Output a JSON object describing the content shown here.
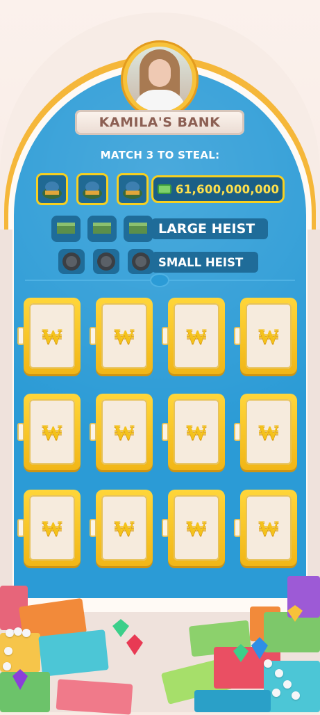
{
  "bank": {
    "owner_title": "KAMILA'S BANK"
  },
  "heist": {
    "instruction": "MATCH 3 TO STEAL:",
    "top_reward": {
      "amount": "61,600,000,000",
      "icon": "cash-stack-icon"
    },
    "tiers": [
      {
        "label": "LARGE HEIST",
        "icon": "cash-bundle-icon"
      },
      {
        "label": "SMALL HEIST",
        "icon": "coin-icon"
      }
    ]
  },
  "vault_doors": [
    {
      "logo": "₩"
    },
    {
      "logo": "₩"
    },
    {
      "logo": "₩"
    },
    {
      "logo": "₩"
    },
    {
      "logo": "₩"
    },
    {
      "logo": "₩"
    },
    {
      "logo": "₩"
    },
    {
      "logo": "₩"
    },
    {
      "logo": "₩"
    },
    {
      "logo": "₩"
    },
    {
      "logo": "₩"
    },
    {
      "logo": "₩"
    }
  ],
  "colors": {
    "panel": "#2b9bd6",
    "gold": "#f7d020",
    "reward_text": "#ffe14b"
  }
}
